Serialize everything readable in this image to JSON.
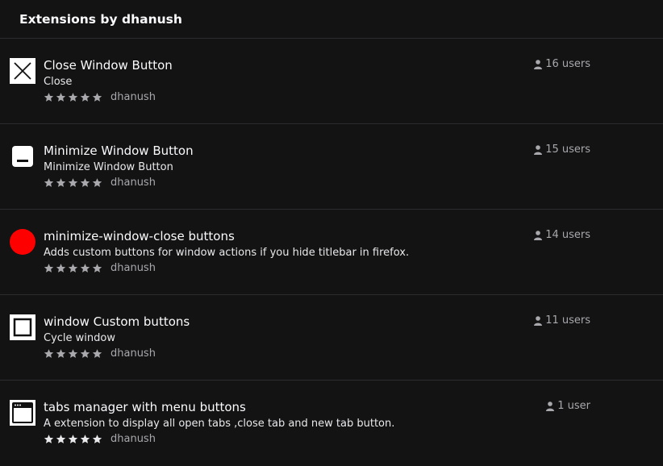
{
  "header": {
    "title": "Extensions by dhanush"
  },
  "extensions": [
    {
      "title": "Close Window Button",
      "description": "Close",
      "author": "dhanush",
      "users": "16 users",
      "icon": "close-x-icon",
      "rating_stars": 5
    },
    {
      "title": "Minimize Window Button",
      "description": "Minimize Window Button",
      "author": "dhanush",
      "users": "15 users",
      "icon": "minimize-icon",
      "rating_stars": 5
    },
    {
      "title": "minimize-window-close buttons",
      "description": "Adds custom buttons for window actions if you hide titlebar in firefox.",
      "author": "dhanush",
      "users": "14 users",
      "icon": "red-circle-icon",
      "rating_stars": 5
    },
    {
      "title": "window Custom buttons",
      "description": "Cycle window",
      "author": "dhanush",
      "users": "11 users",
      "icon": "square-frame-icon",
      "rating_stars": 5
    },
    {
      "title": "tabs manager with menu buttons",
      "description": "A extension to display all open tabs ,close tab and new tab button.",
      "author": "dhanush",
      "users": "1 user",
      "icon": "browser-window-icon",
      "rating_stars": 5
    }
  ],
  "colors": {
    "background": "#131313",
    "divider": "#2c2c2e",
    "star_fill": "#a8a8ad",
    "red_icon": "#ff0000"
  }
}
